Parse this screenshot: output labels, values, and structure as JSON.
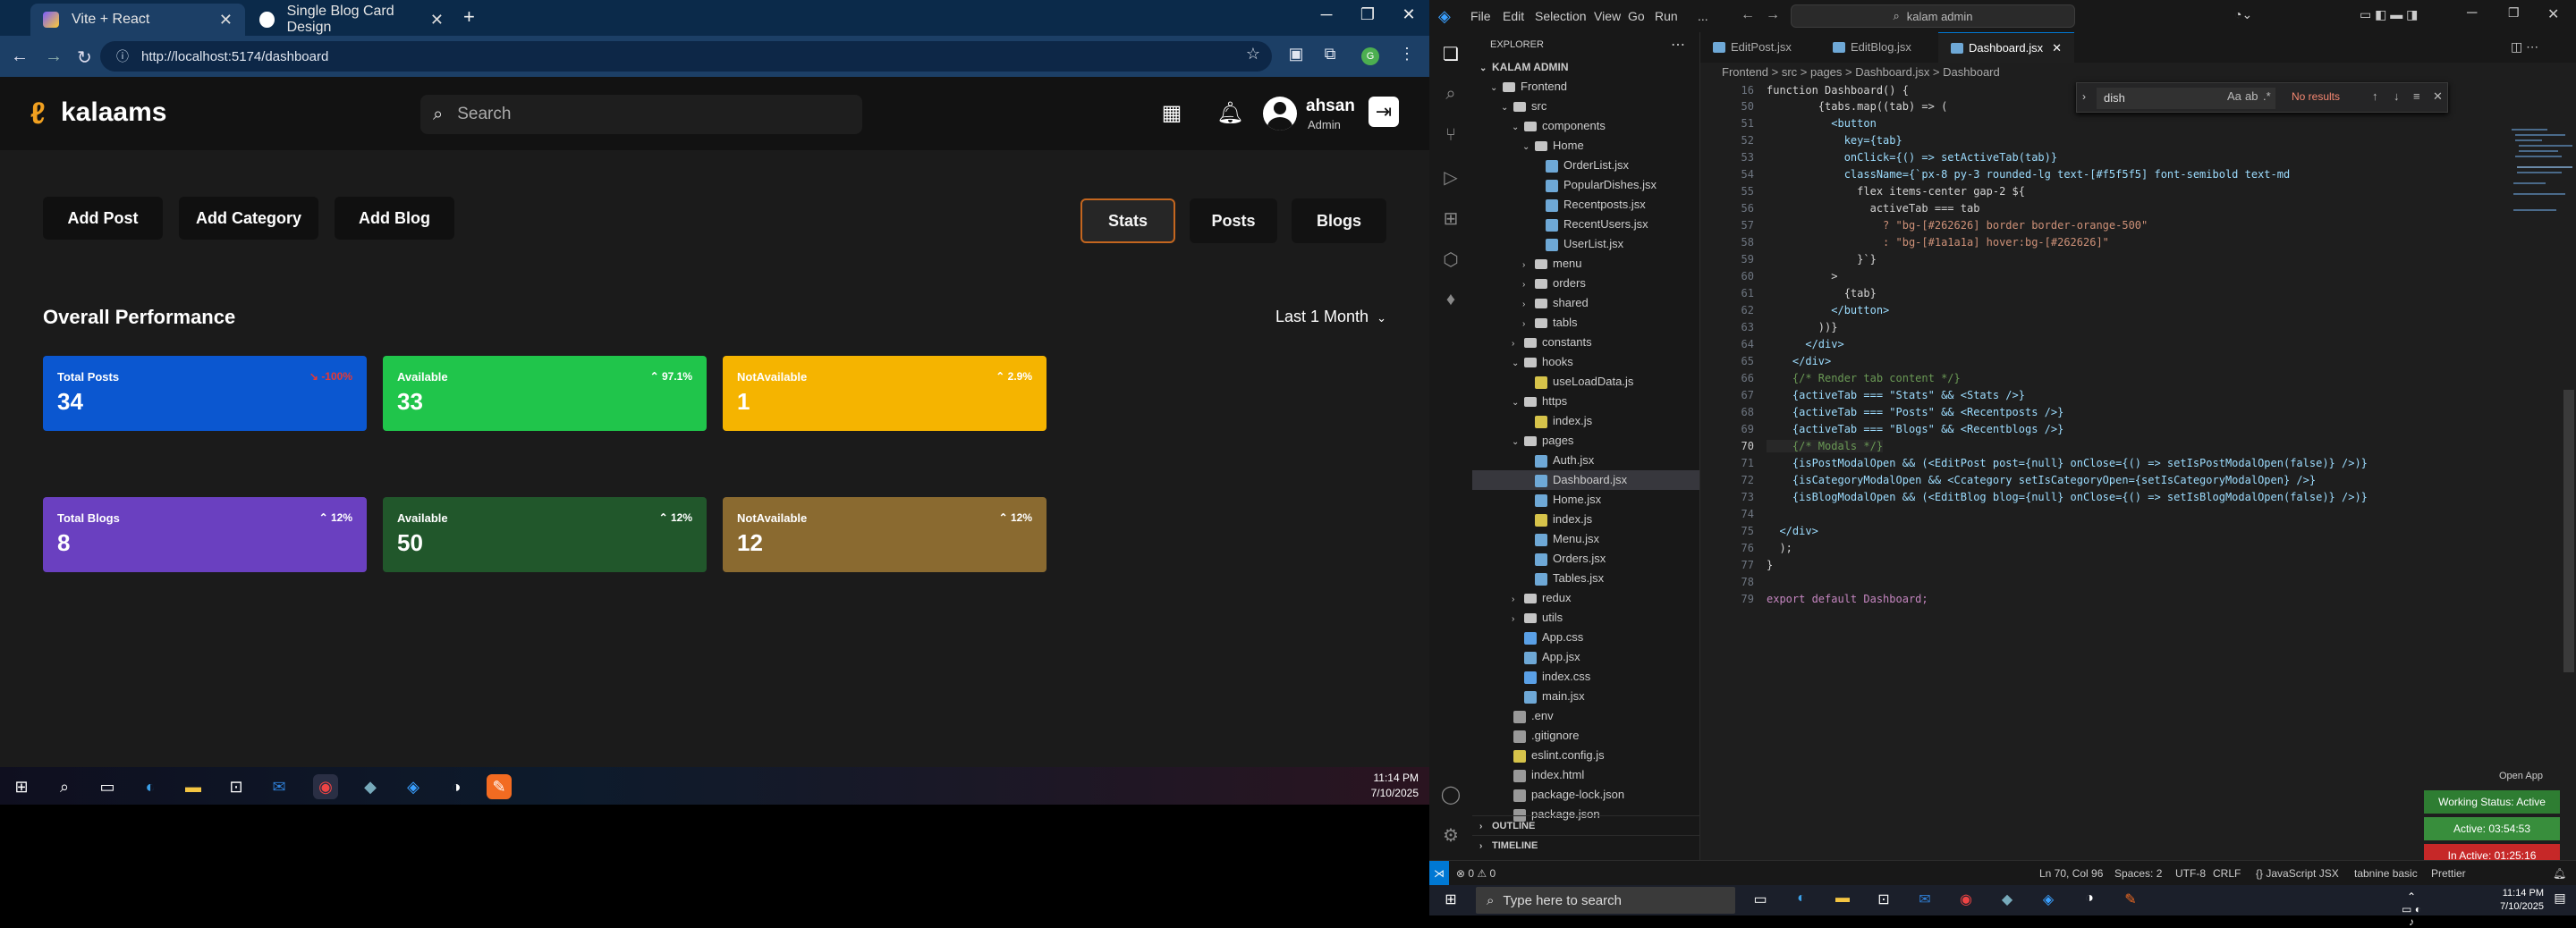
{
  "browser": {
    "tabs": [
      {
        "title": "Vite + React",
        "active": true
      },
      {
        "title": "Single Blog Card Design",
        "active": false
      }
    ],
    "url": "http://localhost:5174/dashboard"
  },
  "app": {
    "brand": "kalaams",
    "search_placeholder": "Search",
    "user": {
      "name": "ahsan",
      "role": "Admin"
    },
    "actions": [
      "Add Post",
      "Add Category",
      "Add Blog"
    ],
    "view_tabs": [
      "Stats",
      "Posts",
      "Blogs"
    ],
    "active_view_tab": "Stats",
    "overview_title": "Overall Performance",
    "range_select": "Last 1 Month",
    "post_cards": [
      {
        "label": "Total Posts",
        "value": "34",
        "change": "-100%",
        "color": "#0b57d0",
        "change_color": "#e53935",
        "change_icon": "arrow-down"
      },
      {
        "label": "Available",
        "value": "33",
        "change": "97.1%",
        "color": "#20c54b",
        "change_color": "#ffffff",
        "change_icon": "arrow-up"
      },
      {
        "label": "NotAvailable",
        "value": "1",
        "change": "2.9%",
        "color": "#f5b400",
        "change_color": "#ffffff",
        "change_icon": "arrow-up"
      }
    ],
    "blog_cards": [
      {
        "label": "Total Blogs",
        "value": "8",
        "change": "12%",
        "color": "#6a40c0",
        "change_color": "#ffffff",
        "change_icon": "arrow-up"
      },
      {
        "label": "Available",
        "value": "50",
        "change": "12%",
        "color": "#21572b",
        "change_color": "#ffffff",
        "change_icon": "arrow-up"
      },
      {
        "label": "NotAvailable",
        "value": "12",
        "change": "12%",
        "color": "#8a6a30",
        "change_color": "#ffffff",
        "change_icon": "arrow-up"
      }
    ]
  },
  "taskbar_left": {
    "time": "11:14 PM",
    "date": "7/10/2025"
  },
  "vscode": {
    "menu": [
      "File",
      "Edit",
      "Selection",
      "View",
      "Go",
      "Run",
      "..."
    ],
    "command_center": "kalam admin",
    "explorer_title": "EXPLORER",
    "workspace": "KALAM ADMIN",
    "tree": [
      {
        "name": "Frontend",
        "type": "folder",
        "open": true
      },
      {
        "name": "src",
        "type": "folder",
        "open": true
      },
      {
        "name": "components",
        "type": "folder",
        "open": true
      },
      {
        "name": "Home",
        "type": "folder",
        "open": true
      },
      {
        "name": "OrderList.jsx",
        "type": "jsx"
      },
      {
        "name": "PopularDishes.jsx",
        "type": "jsx"
      },
      {
        "name": "Recentposts.jsx",
        "type": "jsx"
      },
      {
        "name": "RecentUsers.jsx",
        "type": "jsx"
      },
      {
        "name": "UserList.jsx",
        "type": "jsx"
      },
      {
        "name": "menu",
        "type": "folder"
      },
      {
        "name": "orders",
        "type": "folder"
      },
      {
        "name": "shared",
        "type": "folder"
      },
      {
        "name": "tabls",
        "type": "folder"
      },
      {
        "name": "constants",
        "type": "folder"
      },
      {
        "name": "hooks",
        "type": "folder",
        "open": true
      },
      {
        "name": "useLoadData.js",
        "type": "js"
      },
      {
        "name": "https",
        "type": "folder",
        "open": true
      },
      {
        "name": "index.js",
        "type": "js"
      },
      {
        "name": "pages",
        "type": "folder",
        "open": true
      },
      {
        "name": "Auth.jsx",
        "type": "jsx"
      },
      {
        "name": "Dashboard.jsx",
        "type": "jsx",
        "selected": true
      },
      {
        "name": "Home.jsx",
        "type": "jsx"
      },
      {
        "name": "index.js",
        "type": "js"
      },
      {
        "name": "Menu.jsx",
        "type": "jsx"
      },
      {
        "name": "Orders.jsx",
        "type": "jsx"
      },
      {
        "name": "Tables.jsx",
        "type": "jsx"
      },
      {
        "name": "redux",
        "type": "folder"
      },
      {
        "name": "utils",
        "type": "folder"
      },
      {
        "name": "App.css",
        "type": "css"
      },
      {
        "name": "App.jsx",
        "type": "jsx"
      },
      {
        "name": "index.css",
        "type": "css"
      },
      {
        "name": "main.jsx",
        "type": "jsx"
      },
      {
        "name": ".env",
        "type": "file"
      },
      {
        "name": ".gitignore",
        "type": "file"
      },
      {
        "name": "eslint.config.js",
        "type": "js"
      },
      {
        "name": "index.html",
        "type": "file"
      },
      {
        "name": "package-lock.json",
        "type": "file"
      },
      {
        "name": "package.json",
        "type": "file"
      }
    ],
    "outline": "OUTLINE",
    "timeline": "TIMELINE",
    "editor_tabs": [
      "EditPost.jsx",
      "EditBlog.jsx",
      "Dashboard.jsx"
    ],
    "active_editor_tab": "Dashboard.jsx",
    "breadcrumb": "Frontend > src > pages > Dashboard.jsx > Dashboard",
    "find": {
      "query": "dish",
      "result": "No results"
    },
    "sticky_line": {
      "num": "16",
      "text": "function Dashboard() {"
    },
    "code_lines": [
      {
        "num": "50",
        "text": "        {tabs.map((tab) => ("
      },
      {
        "num": "51",
        "text": "          <button"
      },
      {
        "num": "52",
        "text": "            key={tab}"
      },
      {
        "num": "53",
        "text": "            onClick={() => setActiveTab(tab)}"
      },
      {
        "num": "54",
        "text": "            className={`px-8 py-3 rounded-lg text-[#f5f5f5] font-semibold text-md"
      },
      {
        "num": "55",
        "text": "              flex items-center gap-2 ${"
      },
      {
        "num": "56",
        "text": "                activeTab === tab"
      },
      {
        "num": "57",
        "text": "                  ? \"bg-[#262626] border border-orange-500\""
      },
      {
        "num": "58",
        "text": "                  : \"bg-[#1a1a1a] hover:bg-[#262626]\""
      },
      {
        "num": "59",
        "text": "              }`}"
      },
      {
        "num": "60",
        "text": "          >"
      },
      {
        "num": "61",
        "text": "            {tab}"
      },
      {
        "num": "62",
        "text": "          </button>"
      },
      {
        "num": "63",
        "text": "        ))}"
      },
      {
        "num": "64",
        "text": "      </div>"
      },
      {
        "num": "65",
        "text": "    </div>"
      },
      {
        "num": "66",
        "text": "    {/* Render tab content */}"
      },
      {
        "num": "67",
        "text": "    {activeTab === \"Stats\" && <Stats />}"
      },
      {
        "num": "68",
        "text": "    {activeTab === \"Posts\" && <Recentposts />}"
      },
      {
        "num": "69",
        "text": "    {activeTab === \"Blogs\" && <Recentblogs />}"
      },
      {
        "num": "70",
        "text": "    {/* Modals */}"
      },
      {
        "num": "71",
        "text": "    {isPostModalOpen && (<EditPost post={null} onClose={() => setIsPostModalOpen(false)} />)}"
      },
      {
        "num": "72",
        "text": "    {isCategoryModalOpen && <Ccategory setIsCategoryOpen={setIsCategoryModalOpen} />}"
      },
      {
        "num": "73",
        "text": "    {isBlogModalOpen && (<EditBlog blog={null} onClose={() => setIsBlogModalOpen(false)} />)}"
      },
      {
        "num": "74",
        "text": ""
      },
      {
        "num": "75",
        "text": "  </div>"
      },
      {
        "num": "76",
        "text": "  );"
      },
      {
        "num": "77",
        "text": "}"
      },
      {
        "num": "78",
        "text": ""
      },
      {
        "num": "79",
        "text": "export default Dashboard;"
      }
    ],
    "current_line": "70",
    "status": {
      "left": "⊗ 0  ⚠ 0",
      "position": "Ln 70, Col 96",
      "spaces": "Spaces: 2",
      "encoding": "UTF-8",
      "eol": "CRLF",
      "language": "{} JavaScript JSX",
      "ext": "tabnine basic",
      "prettier": "Prettier"
    },
    "open_app": "Open App",
    "working_status": "Working Status: Active",
    "active_time": "Active: 03:54:53",
    "inactive_time": "In Active: 01:25:16",
    "working_colors": {
      "status": "#2e7d32",
      "active": "#388e3c",
      "inactive": "#c62828"
    }
  },
  "taskbar_right": {
    "search_placeholder": "Type here to search",
    "time": "11:14 PM",
    "date": "7/10/2025"
  }
}
